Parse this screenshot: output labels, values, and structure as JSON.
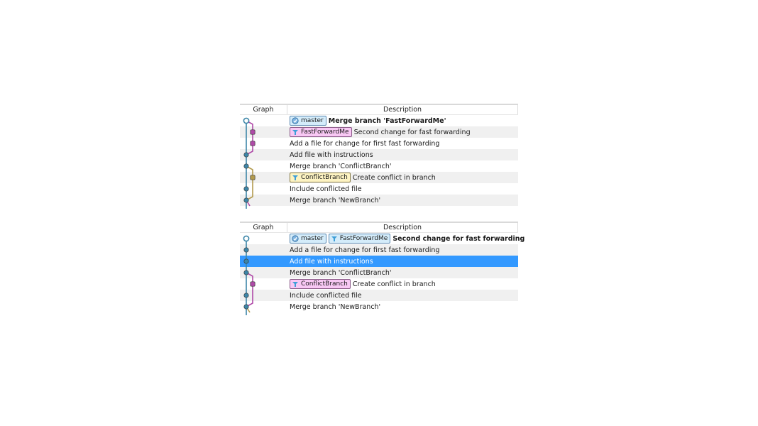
{
  "colors": {
    "trunk": "#3d86a8",
    "fast_forward_branch": "#b04aa8",
    "conflict_branch_panel1": "#b39b4e",
    "conflict_branch_panel2": "#b04aa8",
    "selection": "#3399ff",
    "alt_row": "#f0f0f0"
  },
  "panels": [
    {
      "columns": {
        "graph": "Graph",
        "description": "Description"
      },
      "rows": [
        {
          "refs": [
            {
              "label": "master",
              "style": "blue",
              "icon": "branch-head-icon"
            }
          ],
          "message": "Merge branch 'FastForwardMe'",
          "bold": true,
          "selected": false
        },
        {
          "refs": [
            {
              "label": "FastForwardMe",
              "style": "pink",
              "icon": "branch-icon"
            }
          ],
          "message": "Second change for fast forwarding",
          "bold": false,
          "selected": false
        },
        {
          "refs": [],
          "message": "Add a file for change for first fast forwarding",
          "bold": false,
          "selected": false
        },
        {
          "refs": [],
          "message": "Add file with instructions",
          "bold": false,
          "selected": false
        },
        {
          "refs": [],
          "message": "Merge branch 'ConflictBranch'",
          "bold": false,
          "selected": false
        },
        {
          "refs": [
            {
              "label": "ConflictBranch",
              "style": "yellow",
              "icon": "branch-icon"
            }
          ],
          "message": "Create conflict in branch",
          "bold": false,
          "selected": false
        },
        {
          "refs": [],
          "message": "Include conflicted file",
          "bold": false,
          "selected": false
        },
        {
          "refs": [],
          "message": "Merge branch 'NewBranch'",
          "bold": false,
          "selected": false
        }
      ]
    },
    {
      "columns": {
        "graph": "Graph",
        "description": "Description"
      },
      "rows": [
        {
          "refs": [
            {
              "label": "master",
              "style": "blue",
              "icon": "branch-head-icon"
            },
            {
              "label": "FastForwardMe",
              "style": "blue",
              "icon": "branch-icon"
            }
          ],
          "message": "Second change for fast forwarding",
          "bold": true,
          "selected": false
        },
        {
          "refs": [],
          "message": "Add a file for change for first fast forwarding",
          "bold": false,
          "selected": false
        },
        {
          "refs": [],
          "message": "Add file with instructions",
          "bold": false,
          "selected": true
        },
        {
          "refs": [],
          "message": "Merge branch 'ConflictBranch'",
          "bold": false,
          "selected": false
        },
        {
          "refs": [
            {
              "label": "ConflictBranch",
              "style": "pink",
              "icon": "branch-icon"
            }
          ],
          "message": "Create conflict in branch",
          "bold": false,
          "selected": false
        },
        {
          "refs": [],
          "message": "Include conflicted file",
          "bold": false,
          "selected": false
        },
        {
          "refs": [],
          "message": "Merge branch 'NewBranch'",
          "bold": false,
          "selected": false
        }
      ]
    }
  ]
}
